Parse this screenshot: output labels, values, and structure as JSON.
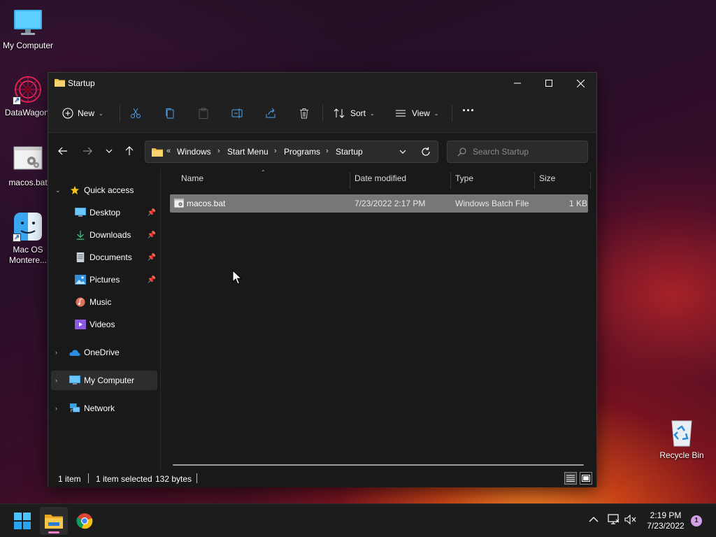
{
  "desktop": {
    "icons": [
      {
        "label": "My Computer"
      },
      {
        "label": "DataWagon."
      },
      {
        "label": "macos.bat"
      },
      {
        "label": "Mac OS Montere..."
      },
      {
        "label": "Recycle Bin"
      }
    ]
  },
  "window": {
    "title": "Startup",
    "toolbar": {
      "new_label": "New",
      "sort_label": "Sort",
      "view_label": "View",
      "more_label": "···"
    },
    "address": {
      "overflow": "«",
      "crumbs": [
        "Windows",
        "Start Menu",
        "Programs",
        "Startup"
      ]
    },
    "search": {
      "placeholder": "Search Startup"
    },
    "nav": {
      "quick_access": "Quick access",
      "items": [
        {
          "label": "Desktop",
          "pinned": true
        },
        {
          "label": "Downloads",
          "pinned": true
        },
        {
          "label": "Documents",
          "pinned": true
        },
        {
          "label": "Pictures",
          "pinned": true
        },
        {
          "label": "Music",
          "pinned": false
        },
        {
          "label": "Videos",
          "pinned": false
        }
      ],
      "onedrive": "OneDrive",
      "my_computer": "My Computer",
      "network": "Network"
    },
    "columns": {
      "name": "Name",
      "date": "Date modified",
      "type": "Type",
      "size": "Size"
    },
    "files": [
      {
        "name": "macos.bat",
        "date": "7/23/2022 2:17 PM",
        "type": "Windows Batch File",
        "size": "1 KB"
      }
    ],
    "status": {
      "count": "1 item",
      "selected": "1 item selected",
      "size": "132 bytes"
    }
  },
  "taskbar": {
    "clock_time": "2:19 PM",
    "clock_date": "7/23/2022",
    "notifications": "1"
  },
  "colors": {
    "accent": "#0078d4",
    "folder": "#f0c24b",
    "selection": "#777777"
  }
}
